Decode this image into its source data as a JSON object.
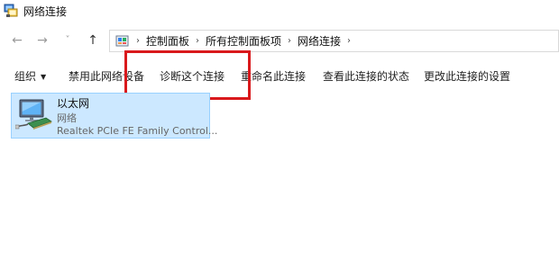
{
  "window": {
    "title": "网络连接",
    "icon": "network-connections-icon"
  },
  "nav": {
    "back_icon": "arrow-left-icon",
    "forward_icon": "arrow-right-icon",
    "recent_icon": "chevron-down-icon",
    "up_icon": "arrow-up-icon",
    "back_glyph": "←",
    "forward_glyph": "→",
    "recent_glyph": "˅",
    "up_glyph": "↑"
  },
  "breadcrumb": {
    "separator": "›",
    "items": [
      "控制面板",
      "所有控制面板项",
      "网络连接"
    ]
  },
  "commands": {
    "organize": "组织",
    "organize_caret": "▼",
    "disable": "禁用此网络设备",
    "diagnose": "诊断这个连接",
    "rename": "重命名此连接",
    "status": "查看此连接的状态",
    "settings": "更改此连接的设置"
  },
  "adapter": {
    "name": "以太网",
    "status": "网络",
    "device": "Realtek PCIe FE Family Control..."
  },
  "colors": {
    "highlight": "#d9191c",
    "selection_bg": "#cce8ff",
    "selection_border": "#99d1ff"
  }
}
